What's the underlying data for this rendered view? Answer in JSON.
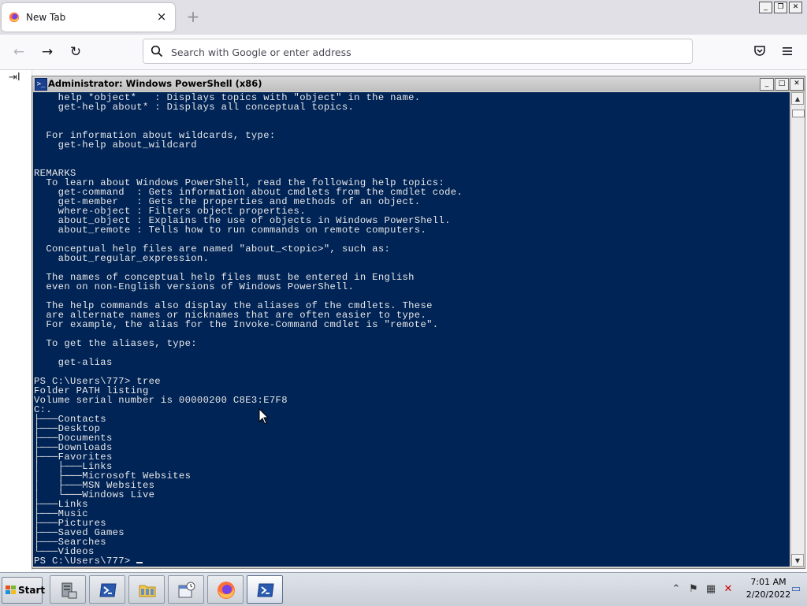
{
  "browser": {
    "tab_title": "New Tab",
    "tab_close": "×",
    "new_tab": "+",
    "search_placeholder": "Search with Google or enter address",
    "sidebar_import_label": "I"
  },
  "powershell": {
    "window_title": "Administrator: Windows PowerShell (x86)",
    "console_lines": [
      "    help *object*   : Displays topics with \"object\" in the name.",
      "    get-help about* : Displays all conceptual topics.",
      "",
      "",
      "  For information about wildcards, type:",
      "    get-help about_wildcard",
      "",
      "",
      "REMARKS",
      "  To learn about Windows PowerShell, read the following help topics:",
      "    get-command  : Gets information about cmdlets from the cmdlet code.",
      "    get-member   : Gets the properties and methods of an object.",
      "    where-object : Filters object properties.",
      "    about_object : Explains the use of objects in Windows PowerShell.",
      "    about_remote : Tells how to run commands on remote computers.",
      "",
      "  Conceptual help files are named \"about_<topic>\", such as:",
      "    about_regular_expression.",
      "",
      "  The names of conceptual help files must be entered in English",
      "  even on non-English versions of Windows PowerShell.",
      "",
      "  The help commands also display the aliases of the cmdlets. These",
      "  are alternate names or nicknames that are often easier to type.",
      "  For example, the alias for the Invoke-Command cmdlet is \"remote\".",
      "",
      "  To get the aliases, type:",
      "",
      "    get-alias",
      "",
      "PS C:\\Users\\777> tree",
      "Folder PATH listing",
      "Volume serial number is 00000200 C8E3:E7F8",
      "C:.",
      "├───Contacts",
      "├───Desktop",
      "├───Documents",
      "├───Downloads",
      "├───Favorites",
      "│   ├───Links",
      "│   ├───Microsoft Websites",
      "│   ├───MSN Websites",
      "│   └───Windows Live",
      "├───Links",
      "├───Music",
      "├───Pictures",
      "├───Saved Games",
      "├───Searches",
      "└───Videos"
    ],
    "prompt": "PS C:\\Users\\777> "
  },
  "taskbar": {
    "start_label": "Start",
    "apps": [
      "server-manager-icon",
      "powershell-icon",
      "explorer-folder-icon",
      "task-scheduler-icon",
      "firefox-icon",
      "powershell-active-icon"
    ],
    "time": "7:01 AM",
    "date": "2/20/2022"
  },
  "colors": {
    "console_bg": "#012456",
    "console_fg": "#e8e8e8"
  }
}
